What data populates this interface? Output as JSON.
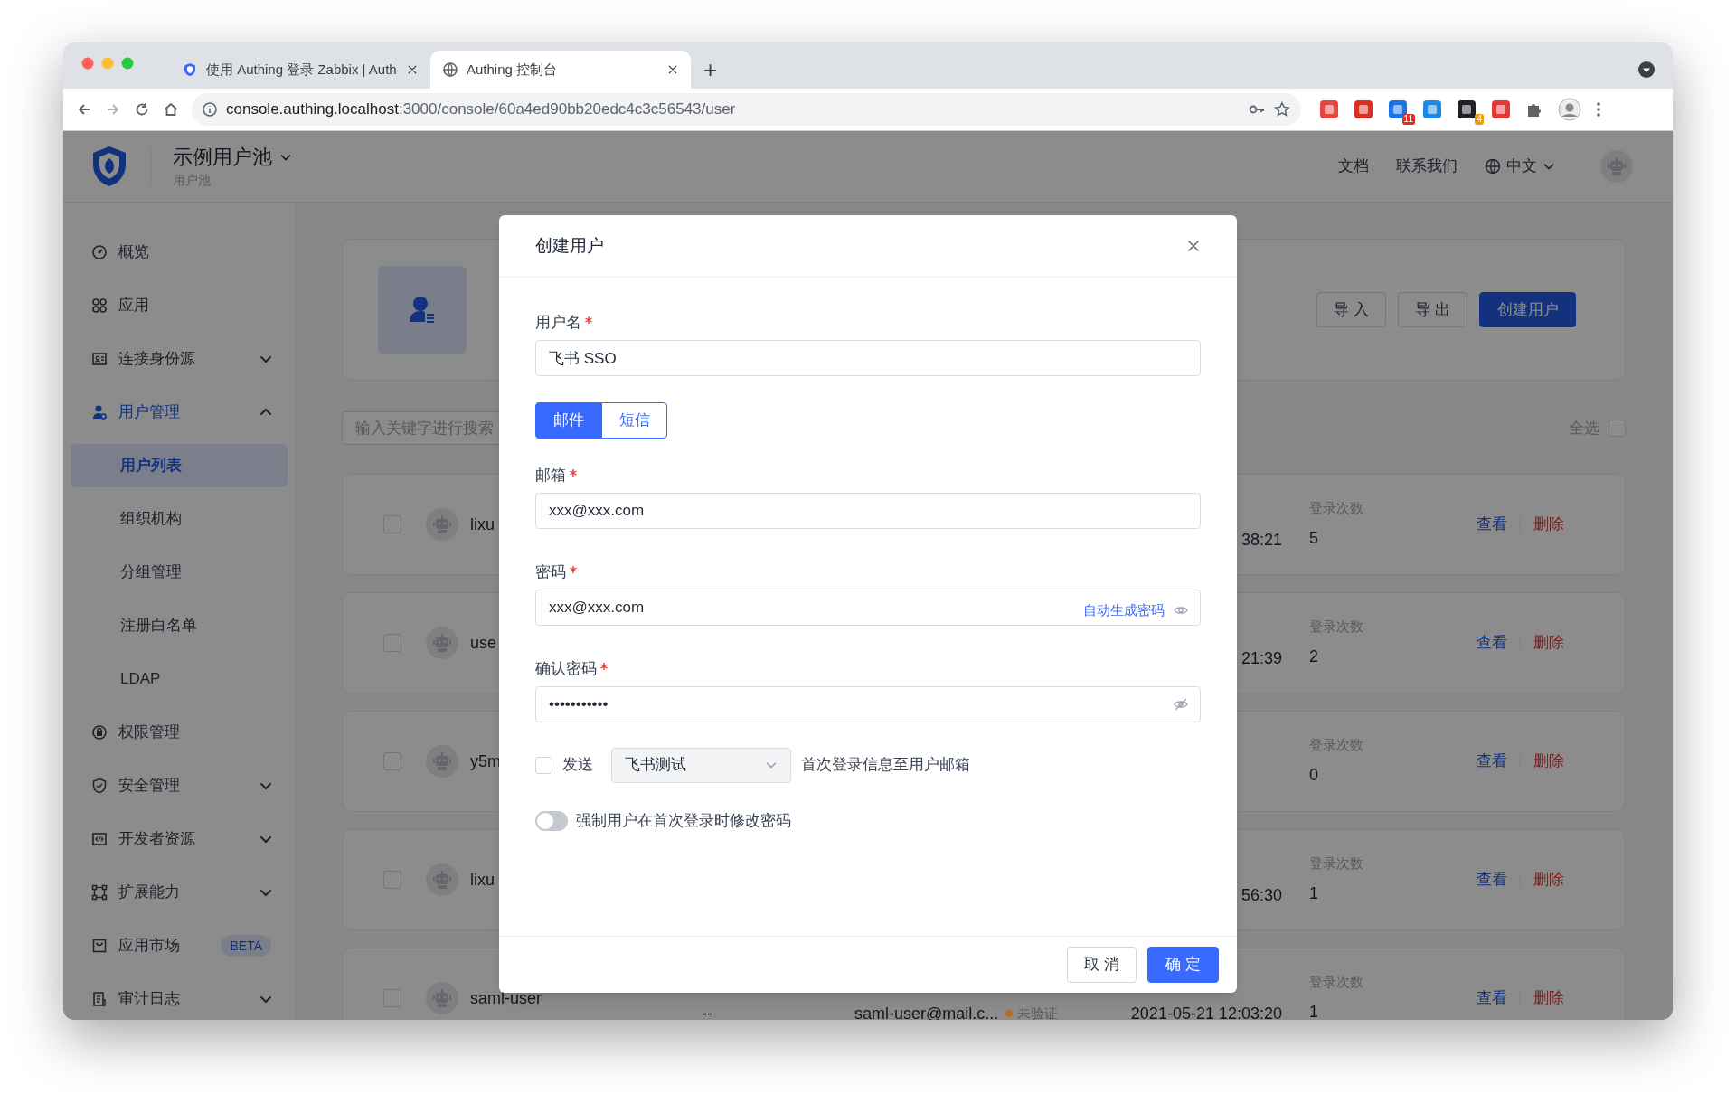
{
  "browser": {
    "tabs": [
      {
        "title": "使用 Authing 登录 Zabbix | Auth",
        "selected": false
      },
      {
        "title": "Authing 控制台",
        "selected": true
      }
    ],
    "new_tab": "+",
    "url_host": "console.authing.localhost",
    "url_path": ":3000/console/60a4ed90bb20edc4c3c56543/user",
    "extensions": [
      {
        "color": "#e8453c"
      },
      {
        "color": "#d93025"
      },
      {
        "color": "#1a73e8",
        "badge": "11"
      },
      {
        "color": "#1e88e5"
      },
      {
        "color": "#202124",
        "badge": "4"
      },
      {
        "color": "#e53935"
      }
    ]
  },
  "header": {
    "pool_name": "示例用户池",
    "pool_label": "用户池",
    "links": [
      "文档",
      "联系我们"
    ],
    "language": "中文"
  },
  "sidebar": [
    {
      "label": "概览",
      "kind": "link"
    },
    {
      "label": "应用",
      "kind": "link"
    },
    {
      "label": "连接身份源",
      "kind": "group",
      "expanded": false
    },
    {
      "label": "用户管理",
      "kind": "group",
      "expanded": true,
      "children": [
        {
          "label": "用户列表",
          "selected": true
        },
        {
          "label": "组织机构",
          "selected": false
        },
        {
          "label": "分组管理",
          "selected": false
        },
        {
          "label": "注册白名单",
          "selected": false
        },
        {
          "label": "LDAP",
          "selected": false
        }
      ]
    },
    {
      "label": "权限管理",
      "kind": "link"
    },
    {
      "label": "安全管理",
      "kind": "group",
      "expanded": false
    },
    {
      "label": "开发者资源",
      "kind": "group",
      "expanded": false
    },
    {
      "label": "扩展能力",
      "kind": "group",
      "expanded": false
    },
    {
      "label": "应用市场",
      "kind": "link",
      "badge": "BETA"
    },
    {
      "label": "审计日志",
      "kind": "group",
      "expanded": false
    }
  ],
  "main": {
    "toolbar_buttons": [
      {
        "label": "导 入",
        "kind": "default"
      },
      {
        "label": "导 出",
        "kind": "default"
      },
      {
        "label": "创建用户",
        "kind": "primary"
      }
    ],
    "search_placeholder": "输入关键字进行搜索",
    "select_all": {
      "label": "全选",
      "checked": false
    },
    "users": [
      {
        "name": "lixu",
        "checked": false,
        "date": "38:21",
        "count_label": "登录次数",
        "count": "5",
        "view": "查看",
        "delete": "删除"
      },
      {
        "name": "use",
        "checked": false,
        "date": "21:39",
        "count_label": "登录次数",
        "count": "2",
        "view": "查看",
        "delete": "删除"
      },
      {
        "name": "y5m",
        "checked": false,
        "count_label": "登录次数",
        "count": "0",
        "view": "查看",
        "delete": "删除"
      },
      {
        "name": "lixu",
        "checked": false,
        "date": "56:30",
        "count_label": "登录次数",
        "count": "1",
        "view": "查看",
        "delete": "删除"
      },
      {
        "name": "saml-user",
        "checked": false,
        "phone": "--",
        "email": "saml-user@mail.c...",
        "status": "未验证",
        "color": "#b86e1a",
        "date": "2021-05-21 12:03:20",
        "count_label": "登录次数",
        "count": "1",
        "view": "查看",
        "delete": "删除"
      }
    ]
  },
  "dialog": {
    "title": "创建用户",
    "username": {
      "label": "用户名",
      "required": true,
      "value": "飞书 SSO"
    },
    "channel_tabs": [
      {
        "label": "邮件",
        "selected": true
      },
      {
        "label": "短信",
        "selected": false
      }
    ],
    "email": {
      "label": "邮箱",
      "required": true,
      "value": "xxx@xxx.com"
    },
    "password": {
      "label": "密码",
      "required": true,
      "value": "xxx@xxx.com",
      "action": "自动生成密码",
      "masked": false
    },
    "confirm_password": {
      "label": "确认密码",
      "required": true,
      "value": "•••••••••••",
      "masked": true
    },
    "send": {
      "checked": false,
      "label": "发送",
      "template": "飞书测试",
      "suffix": "首次登录信息至用户邮箱"
    },
    "force_reset": {
      "on": false,
      "label": "强制用户在首次登录时修改密码"
    },
    "buttons": [
      {
        "label": "取 消",
        "kind": "default"
      },
      {
        "label": "确 定",
        "kind": "primary"
      }
    ]
  }
}
